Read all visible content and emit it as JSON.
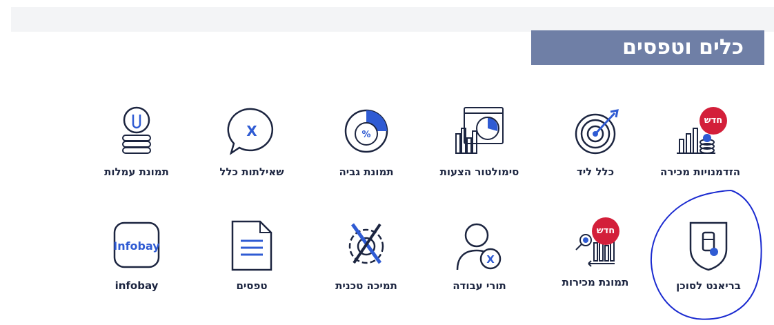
{
  "section_title": "כלים וטפסים",
  "badge_new": "חדש",
  "row1": [
    {
      "label": "הזדמנויות מכירה",
      "icon": "sales-opportunities-icon"
    },
    {
      "label": "כלל ליד",
      "icon": "target-icon"
    },
    {
      "label": "סימולטור הצעות",
      "icon": "offer-simulator-icon"
    },
    {
      "label": "תמונת גביה",
      "icon": "collection-pie-icon"
    },
    {
      "label": "שאילתות כלל",
      "icon": "chat-bubble-icon"
    },
    {
      "label": "תמונת עמלות",
      "icon": "coins-icon"
    }
  ],
  "row2": [
    {
      "label": "בריאנט לסוכן",
      "icon": "shield-medicine-icon"
    },
    {
      "label": "תמונת מכירות",
      "icon": "sales-chart-icon"
    },
    {
      "label": "תורי עבודה",
      "icon": "agent-person-icon"
    },
    {
      "label": "תמיכה טכנית",
      "icon": "gear-wrench-icon"
    },
    {
      "label": "טפסים",
      "icon": "document-icon"
    },
    {
      "label": "infobay",
      "icon": "infobay-icon",
      "logo_text": "Infobay"
    }
  ],
  "colors": {
    "accent": "#6f7fa6",
    "icon_blue": "#2f5bd3",
    "badge_red": "#d31f3a",
    "annotation": "#1a2ad0"
  }
}
